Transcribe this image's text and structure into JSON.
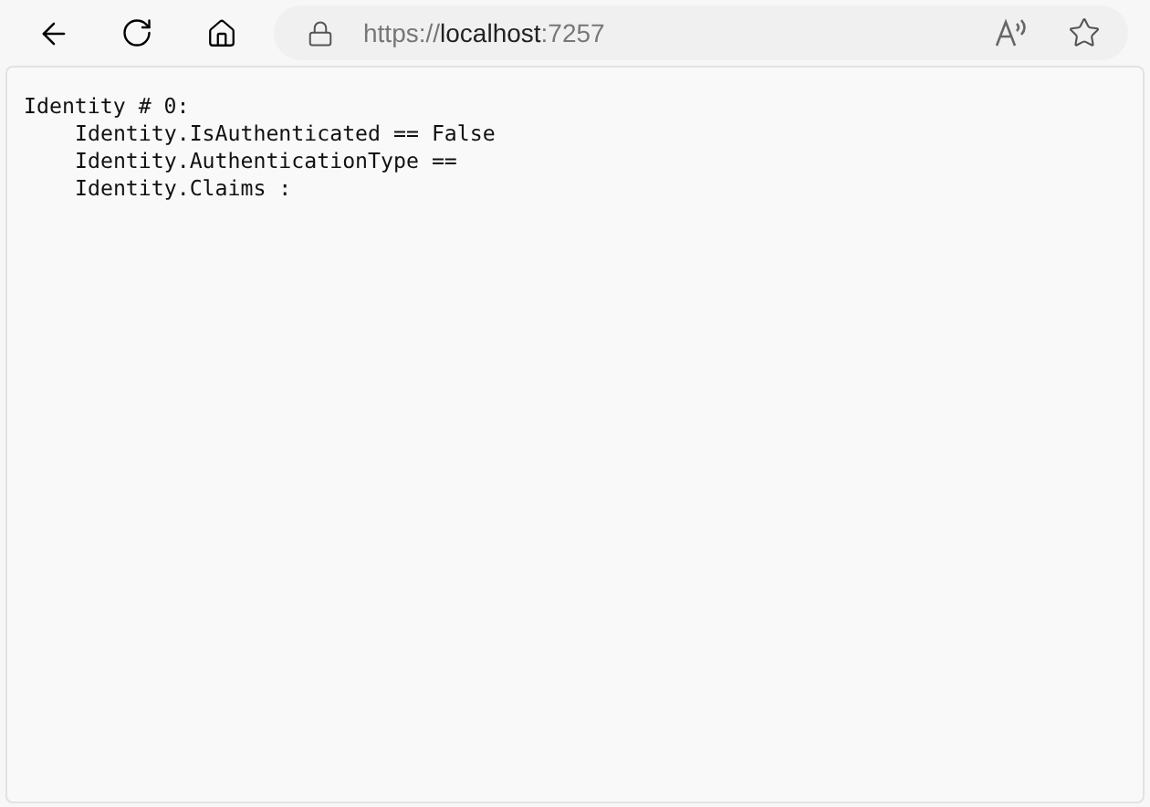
{
  "toolbar": {
    "address": {
      "scheme": "https://",
      "host": "localhost",
      "port": ":7257"
    }
  },
  "page": {
    "identities": [
      {
        "heading": "Identity # 0:",
        "children": [
          "Identity.IsAuthenticated == False",
          "Identity.AuthenticationType ==",
          "Identity.Claims :"
        ]
      }
    ]
  }
}
